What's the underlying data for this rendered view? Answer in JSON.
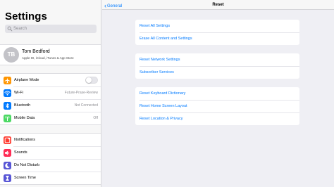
{
  "left": {
    "title": "Settings",
    "search": {
      "placeholder": "Search",
      "icon": "magnifier-icon"
    },
    "profile": {
      "initials": "TB",
      "name": "Tom Bedford",
      "subtitle": "Apple ID, iCloud, iTunes & App Store"
    },
    "group1": [
      {
        "label": "Airplane Mode",
        "icon": "airplane-icon",
        "color": "#ff9500",
        "toggle": false
      },
      {
        "label": "Wi-Fi",
        "icon": "wifi-icon",
        "color": "#007aff",
        "value": "Future-Prase-Review"
      },
      {
        "label": "Bluetooth",
        "icon": "bluetooth-icon",
        "color": "#007aff",
        "value": "Not Connected"
      },
      {
        "label": "Mobile Data",
        "icon": "antenna-icon",
        "color": "#4cd964",
        "value": "Off"
      }
    ],
    "group2": [
      {
        "label": "Notifications",
        "icon": "notifications-icon",
        "color": "#ff3b30"
      },
      {
        "label": "Sounds",
        "icon": "speaker-icon",
        "color": "#ff2d55"
      },
      {
        "label": "Do Not Disturb",
        "icon": "moon-icon",
        "color": "#5856d6"
      },
      {
        "label": "Screen Time",
        "icon": "hourglass-icon",
        "color": "#5856d6"
      }
    ]
  },
  "right": {
    "back_label": "General",
    "title": "Reset",
    "group1": [
      "Reset All Settings",
      "Erase All Content and Settings"
    ],
    "group2": [
      "Reset Network Settings",
      "Subscriber Services"
    ],
    "group3": [
      "Reset Keyboard Dictionary",
      "Reset Home Screen Layout",
      "Reset Location & Privacy"
    ]
  },
  "colors": {
    "accent": "#007aff",
    "background": "#efeff4"
  }
}
